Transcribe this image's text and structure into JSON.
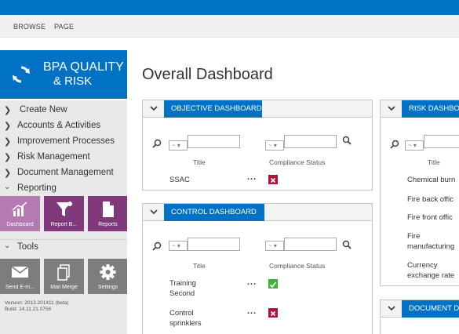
{
  "ribbon": {
    "browse": "BROWSE",
    "page": "PAGE"
  },
  "logo": {
    "line1": "BPA QUALITY",
    "line2": "& RISK"
  },
  "nav": {
    "items": [
      {
        "label": "Create New",
        "expanded": false
      },
      {
        "label": "Accounts & Activities",
        "expanded": false
      },
      {
        "label": "Improvement Processes",
        "expanded": false
      },
      {
        "label": "Risk Management",
        "expanded": false
      },
      {
        "label": "Document Management",
        "expanded": false
      },
      {
        "label": "Reporting",
        "expanded": true
      }
    ],
    "reporting_tiles": [
      {
        "label": "Dashboard",
        "icon": "chart-icon",
        "selected": true
      },
      {
        "label": "Report B...",
        "icon": "filter-icon",
        "selected": false
      },
      {
        "label": "Reports",
        "icon": "document-icon",
        "selected": false
      }
    ],
    "tools_label": "Tools",
    "tools_tiles": [
      {
        "label": "Send E-m...",
        "icon": "mail-icon"
      },
      {
        "label": "Mail Merge",
        "icon": "copy-icon"
      },
      {
        "label": "Settings",
        "icon": "gear-icon"
      }
    ]
  },
  "version": {
    "line1": "Version: 2013.201411 (beta)",
    "line2": "Build: 14.11.21.0756"
  },
  "page_title": "Overall Dashboard",
  "objective": {
    "title": "OBJECTIVE DASHBOARD",
    "filter": "~ ▾",
    "col_title": "Title",
    "col_status": "Compliance Status",
    "rows": [
      {
        "title": "SSAC",
        "dots": "...",
        "status": "fail"
      }
    ]
  },
  "control": {
    "title": "CONTROL DASHBOARD",
    "filter": "~ ▾",
    "col_title": "Title",
    "col_status": "Compliance Status",
    "rows": [
      {
        "title1": "Training",
        "title2": "Second",
        "dots": "...",
        "status": "pass"
      },
      {
        "title1": "Control",
        "title2": "sprinklers",
        "dots": "...",
        "status": "fail"
      }
    ]
  },
  "risk": {
    "title": "RISK DASHBO",
    "filter": "~ ▾",
    "col_title": "Title",
    "rows": [
      {
        "l1": "Chemical burn",
        "l2": ""
      },
      {
        "l1": "Fire back offic",
        "l2": ""
      },
      {
        "l1": "Fire front offic",
        "l2": ""
      },
      {
        "l1": "Fire",
        "l2": "manufacturing"
      },
      {
        "l1": "Currency",
        "l2": "exchange rate"
      }
    ]
  },
  "document": {
    "title": "DOCUMENT D"
  },
  "colors": {
    "brand": "#0072c6",
    "tile_purple": "#80397b",
    "tile_gray": "#7d7d7d",
    "status_fail": "#b3143e",
    "status_pass": "#3fb23a"
  }
}
